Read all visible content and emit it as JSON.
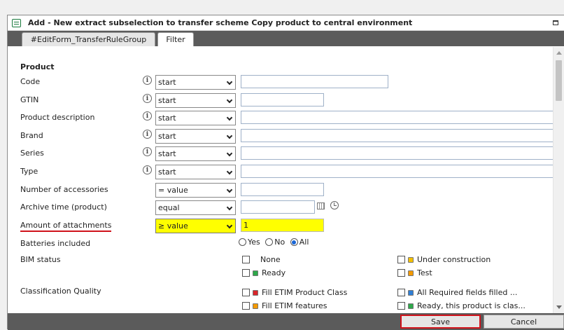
{
  "window": {
    "title": "Add - New extract subselection to transfer scheme Copy product to central environment"
  },
  "tabs": [
    {
      "label": "#EditForm_TransferRuleGroup"
    },
    {
      "label": "Filter"
    }
  ],
  "section": {
    "title": "Product"
  },
  "rows": [
    {
      "label": "Code",
      "operator": "start",
      "value": ""
    },
    {
      "label": "GTIN",
      "operator": "start",
      "value": ""
    },
    {
      "label": "Product description",
      "operator": "start",
      "value": ""
    },
    {
      "label": "Brand",
      "operator": "start",
      "value": ""
    },
    {
      "label": "Series",
      "operator": "start",
      "value": ""
    },
    {
      "label": "Type",
      "operator": "start",
      "value": ""
    },
    {
      "label": "Number of accessories",
      "operator": "= value",
      "value": ""
    },
    {
      "label": "Archive time (product)",
      "operator": "equal",
      "value": ""
    },
    {
      "label": "Amount of attachments",
      "operator": "≥ value",
      "value": "1"
    }
  ],
  "batteries": {
    "label": "Batteries included",
    "options": [
      "Yes",
      "No",
      "All"
    ],
    "selected": "All"
  },
  "bim_status": {
    "label": "BIM status",
    "options": [
      {
        "label": "None",
        "color": ""
      },
      {
        "label": "Under construction",
        "color": "#f4c000"
      },
      {
        "label": "Ready",
        "color": "#2ea84a"
      },
      {
        "label": "Test",
        "color": "#f49a00"
      }
    ]
  },
  "classification_quality": {
    "label": "Classification Quality",
    "options": [
      {
        "label": "Fill ETIM Product Class",
        "color": "#d9252b"
      },
      {
        "label": "All Required fields filled ...",
        "color": "#2f7fd6"
      },
      {
        "label": "Fill ETIM features",
        "color": "#f49a00"
      },
      {
        "label": "Ready, this product is clas...",
        "color": "#2ea84a"
      }
    ]
  },
  "footer": {
    "save_label": "Save",
    "cancel_label": "Cancel"
  },
  "colors": {
    "highlight": "#ffff00",
    "annotation": "#d0121b",
    "bar": "#5b5b5b"
  }
}
